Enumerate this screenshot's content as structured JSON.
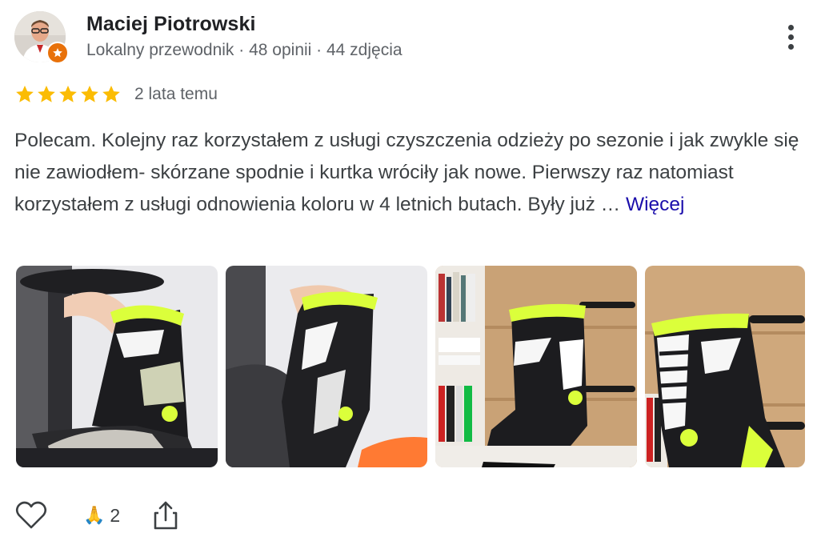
{
  "reviewer": {
    "name": "Maciej Piotrowski",
    "meta": "Lokalny przewodnik · 48 opinii · 44 zdjęcia",
    "avatar_icon": "user-avatar",
    "badge_icon": "local-guide-star-icon",
    "badge_color": "#e8710a"
  },
  "review": {
    "rating": 5,
    "rating_max": 5,
    "star_color": "#fbbc04",
    "time": "2 lata temu",
    "text": "Polecam. Kolejny raz korzystałem z usługi czyszczenia odzieży po sezonie i jak zwykle się nie zawiodłem- skórzane spodnie i kurtka wróciły jak nowe. Pierwszy raz natomiast korzystałem z usługi odnowienia koloru w 4 letnich butach. Były już …",
    "more_label": "Więcej",
    "link_color": "#1a0dab"
  },
  "photos": [
    {
      "label": "photo-1"
    },
    {
      "label": "photo-2"
    },
    {
      "label": "photo-3"
    },
    {
      "label": "photo-4"
    }
  ],
  "actions": {
    "like_icon": "heart-outline-icon",
    "reaction_emoji": "🙏",
    "reaction_count": "2",
    "share_icon": "share-icon"
  }
}
